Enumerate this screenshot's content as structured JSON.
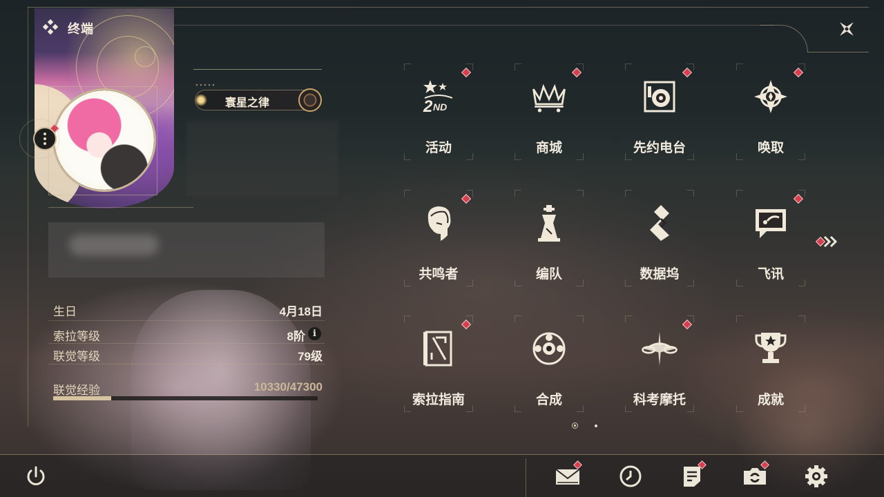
{
  "window": {
    "title": "终端"
  },
  "colors": {
    "accent_gold": "#cbb999",
    "badge_red": "#d6404e",
    "text_light": "#f1ebdf"
  },
  "profile": {
    "nameplate": "寰星之律",
    "birthday_label": "生日",
    "birthday_value": "4月18日",
    "sola_level_label": "索拉等级",
    "sola_level_value": "8阶",
    "union_level_label": "联觉等级",
    "union_level_value": "79级",
    "union_exp_label": "联觉经验",
    "union_exp_value": "10330/47300",
    "union_exp_current": 10330,
    "union_exp_max": 47300
  },
  "menu": {
    "items": [
      {
        "label": "活动",
        "icon": "event-2nd-icon",
        "badge": true
      },
      {
        "label": "商城",
        "icon": "shop-icon",
        "badge": true
      },
      {
        "label": "先约电台",
        "icon": "radio-icon",
        "badge": true
      },
      {
        "label": "唤取",
        "icon": "convene-icon",
        "badge": true
      },
      {
        "label": "共鸣者",
        "icon": "resonator-icon",
        "badge": true
      },
      {
        "label": "编队",
        "icon": "team-icon",
        "badge": false
      },
      {
        "label": "数据坞",
        "icon": "data-bank-icon",
        "badge": false
      },
      {
        "label": "飞讯",
        "icon": "message-icon",
        "badge": true
      },
      {
        "label": "索拉指南",
        "icon": "guidebook-icon",
        "badge": true
      },
      {
        "label": "合成",
        "icon": "synthesis-icon",
        "badge": false
      },
      {
        "label": "科考摩托",
        "icon": "motorbike-icon",
        "badge": true
      },
      {
        "label": "成就",
        "icon": "trophy-icon",
        "badge": false
      }
    ],
    "page_current": 1,
    "page_count": 2
  },
  "bottom_bar": {
    "items": [
      {
        "icon": "power-icon",
        "badge": false
      },
      {
        "icon": "mail-icon",
        "badge": true
      },
      {
        "icon": "clock-icon",
        "badge": false
      },
      {
        "icon": "notice-icon",
        "badge": true
      },
      {
        "icon": "camera-icon",
        "badge": true
      },
      {
        "icon": "gear-icon",
        "badge": false
      }
    ]
  }
}
